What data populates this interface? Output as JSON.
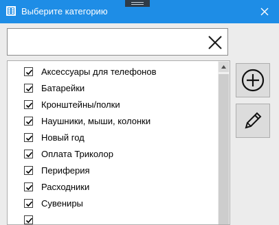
{
  "window": {
    "title": "Выберите категорию"
  },
  "search": {
    "value": "",
    "placeholder": ""
  },
  "categories": {
    "items": [
      {
        "label": "Аксессуары для телефонов",
        "checked": true
      },
      {
        "label": "Батарейки",
        "checked": true
      },
      {
        "label": "Кронштейны/полки",
        "checked": true
      },
      {
        "label": "Наушники, мыши, колонки",
        "checked": true
      },
      {
        "label": "Новый год",
        "checked": true
      },
      {
        "label": "Оплата Триколор",
        "checked": true
      },
      {
        "label": "Периферия",
        "checked": true
      },
      {
        "label": "Расходники",
        "checked": true
      },
      {
        "label": "Сувениры",
        "checked": true
      },
      {
        "label": "",
        "checked": true
      }
    ]
  },
  "actions": {
    "add_icon": "plus-circle-icon",
    "edit_icon": "pencil-icon"
  },
  "colors": {
    "titlebar": "#1e8de6",
    "background": "#ececec",
    "button": "#dcdcdc"
  }
}
